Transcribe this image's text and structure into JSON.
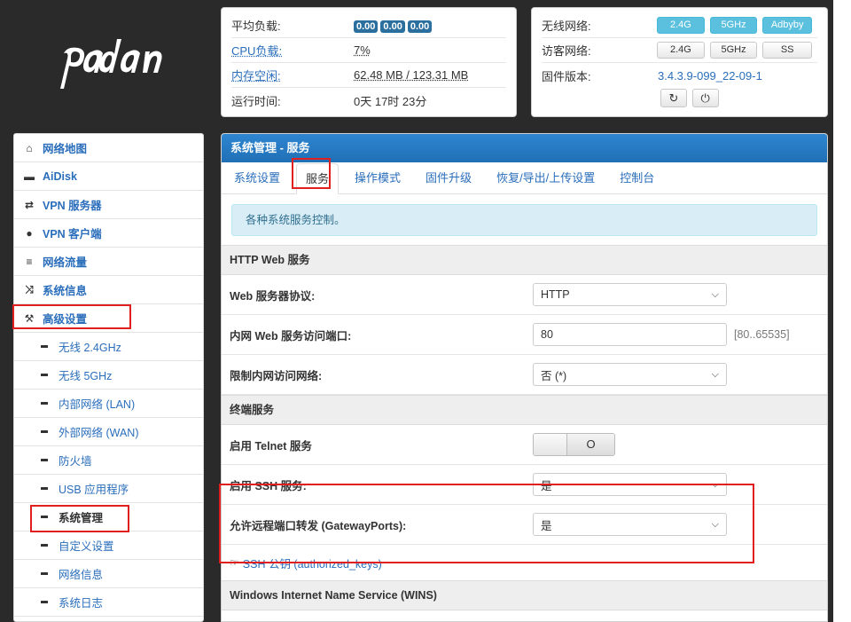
{
  "logo_text": "padavan",
  "status_left": {
    "rows": [
      {
        "label": "平均负载:",
        "loads": [
          "0.00",
          "0.00",
          "0.00"
        ]
      },
      {
        "label": "CPU负载:",
        "value": "7%"
      },
      {
        "label": "内存空闲:",
        "value": "62.48 MB / 123.31 MB"
      },
      {
        "label": "运行时间:",
        "value": "0天 17时 23分"
      }
    ]
  },
  "status_right": {
    "wireless_label": "无线网络:",
    "wireless_buttons": [
      "2.4G",
      "5GHz",
      "Adbyby"
    ],
    "guest_label": "访客网络:",
    "guest_buttons": [
      "2.4G",
      "5GHz",
      "SS"
    ],
    "firmware_label": "固件版本:",
    "firmware_value": "3.4.3.9-099_22-09-1",
    "icons": [
      "refresh-icon",
      "power-icon"
    ]
  },
  "sidebar": {
    "items": [
      {
        "label": "网络地图",
        "icon": "home-icon"
      },
      {
        "label": "AiDisk",
        "icon": "disk-icon"
      },
      {
        "label": "VPN 服务器",
        "icon": "retweet-icon"
      },
      {
        "label": "VPN 客户端",
        "icon": "globe-icon"
      },
      {
        "label": "网络流量",
        "icon": "hdd-icon"
      },
      {
        "label": "系统信息",
        "icon": "shuffle-icon"
      },
      {
        "label": "高级设置",
        "icon": "wrench-icon"
      }
    ],
    "sub_items": [
      {
        "label": "无线 2.4GHz"
      },
      {
        "label": "无线 5GHz"
      },
      {
        "label": "内部网络 (LAN)"
      },
      {
        "label": "外部网络 (WAN)"
      },
      {
        "label": "防火墙"
      },
      {
        "label": "USB 应用程序"
      },
      {
        "label": "系统管理"
      },
      {
        "label": "自定义设置"
      },
      {
        "label": "网络信息"
      },
      {
        "label": "系统日志"
      }
    ]
  },
  "main": {
    "title": "系统管理 - 服务",
    "tabs": [
      "系统设置",
      "服务",
      "操作模式",
      "固件升级",
      "恢复/导出/上传设置",
      "控制台"
    ],
    "active_tab": "服务",
    "info": "各种系统服务控制。",
    "http_section": "HTTP Web 服务",
    "web_protocol_label": "Web 服务器协议:",
    "web_protocol_value": "HTTP",
    "web_port_label": "内网 Web 服务访问端口:",
    "web_port_value": "80",
    "web_port_hint": "[80..65535]",
    "restrict_label": "限制内网访问网络:",
    "restrict_value": "否 (*)",
    "terminal_section": "终端服务",
    "telnet_label": "启用 Telnet 服务",
    "telnet_toggle_symbol": "O",
    "ssh_label": "启用 SSH 服务:",
    "ssh_value": "是",
    "gateway_label": "允许远程端口转发 (GatewayPorts):",
    "gateway_value": "是",
    "ssh_keys_link": "SSH 公钥 (authorized_keys)",
    "wins_section": "Windows Internet Name Service (WINS)"
  }
}
